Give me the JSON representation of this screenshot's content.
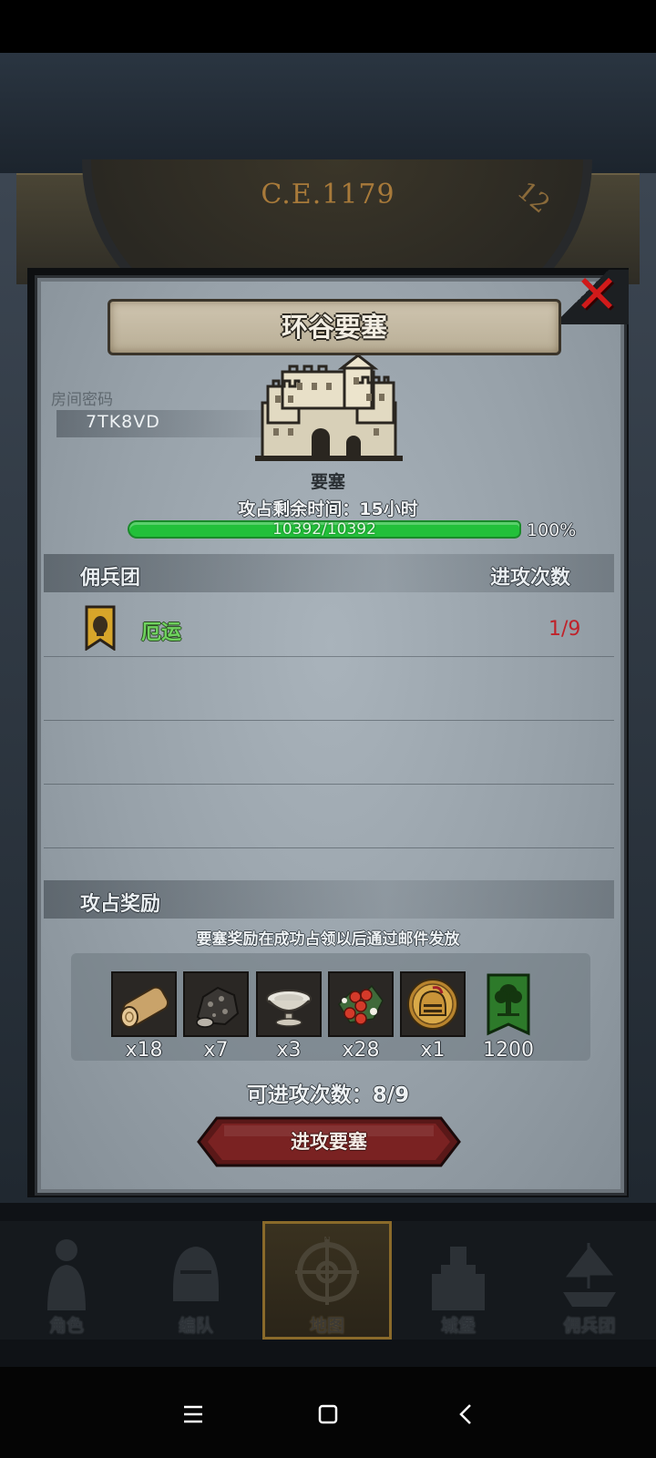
{
  "background": {
    "era_label": "C.E.1179",
    "dial_number": "12"
  },
  "modal": {
    "title": "环谷要塞",
    "room": {
      "label": "房间密码",
      "code": "7TK8VD"
    },
    "building_type": "要塞",
    "time_label": "攻占剩余时间：15小时",
    "hp": {
      "current": 10392,
      "max": 10392,
      "text": "10392/10392",
      "percent_text": "100%"
    },
    "mercenary_section": {
      "label": "佣兵团",
      "count_header": "进攻次数"
    },
    "mercenaries": [
      {
        "name": "厄运",
        "count": "1/9",
        "icon": "banner-icon"
      }
    ],
    "reward_section": {
      "label": "攻占奖励",
      "note": "要塞奖励在成功占领以后通过邮件发放",
      "items": [
        {
          "icon": "wood-log-icon",
          "qty": "x18"
        },
        {
          "icon": "ore-rock-icon",
          "qty": "x7"
        },
        {
          "icon": "bowl-icon",
          "qty": "x3"
        },
        {
          "icon": "berries-icon",
          "qty": "x28"
        },
        {
          "icon": "helmet-icon",
          "qty": "x1"
        },
        {
          "icon": "tree-banner-icon",
          "qty": "1200"
        }
      ]
    },
    "attack_count": "可进攻次数：8/9",
    "attack_button": "进攻要塞"
  },
  "nav": {
    "tabs": [
      {
        "label": "角色",
        "icon": "knight-icon"
      },
      {
        "label": "编队",
        "icon": "helmet-icon"
      },
      {
        "label": "地图",
        "icon": "compass-icon",
        "active": true
      },
      {
        "label": "城堡",
        "icon": "castle-icon"
      },
      {
        "label": "佣兵团",
        "icon": "ship-icon"
      }
    ]
  },
  "colors": {
    "hp_bar": "#22c03a",
    "merc_name": "#6fd35e",
    "merc_count": "#c0222a",
    "close": "#d11a1a",
    "attack_button": "#7a2222"
  }
}
